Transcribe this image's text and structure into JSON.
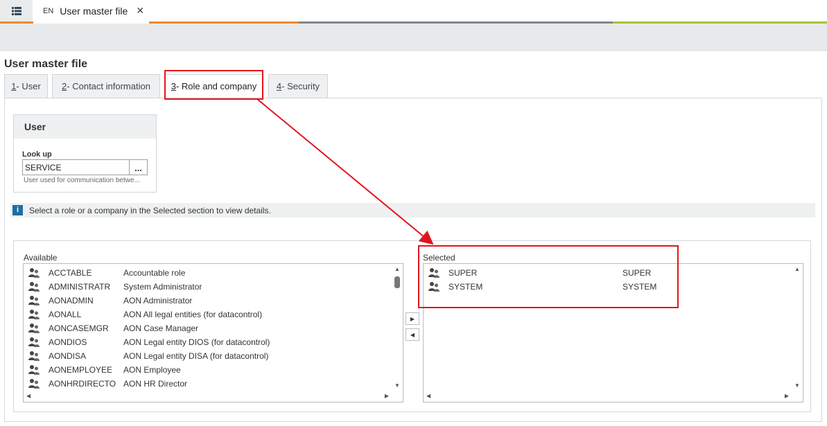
{
  "top_tab": {
    "lang": "EN",
    "title": "User master file",
    "close": "✕"
  },
  "page_title": "User master file",
  "tabs": [
    {
      "num": "1",
      "label": " - User"
    },
    {
      "num": "2",
      "label": " - Contact information"
    },
    {
      "num": "3",
      "label": " - Role and company"
    },
    {
      "num": "4",
      "label": " - Security"
    }
  ],
  "user_box": {
    "header": "User",
    "lookup_label": "Look up",
    "lookup_value": "SERVICE",
    "lookup_btn": "...",
    "help": "User used for communication betwe..."
  },
  "info": {
    "icon": "i",
    "text": "Select a role or a company in the Selected section to view details."
  },
  "available": {
    "label": "Available",
    "rows": [
      {
        "code": "ACCTABLE",
        "desc": "Accountable role"
      },
      {
        "code": "ADMINISTRATR",
        "desc": "System Administrator"
      },
      {
        "code": "AONADMIN",
        "desc": "AON Administrator"
      },
      {
        "code": "AONALL",
        "desc": "AON All legal entities (for datacontrol)"
      },
      {
        "code": "AONCASEMGR",
        "desc": "AON Case Manager"
      },
      {
        "code": "AONDIOS",
        "desc": "AON Legal entity DIOS (for datacontrol)"
      },
      {
        "code": "AONDISA",
        "desc": "AON Legal entity DISA (for datacontrol)"
      },
      {
        "code": "AONEMPLOYEE",
        "desc": "AON Employee"
      },
      {
        "code": "AONHRDIRECTO",
        "desc": "AON HR Director"
      }
    ]
  },
  "selected": {
    "label": "Selected",
    "rows": [
      {
        "code": "SUPER",
        "desc": "SUPER"
      },
      {
        "code": "SYSTEM",
        "desc": "SYSTEM"
      }
    ]
  },
  "icons": {
    "menu": "menu-list-icon",
    "role": "user-group-icon",
    "info": "info-icon"
  },
  "colors": {
    "stripe_orange": "#f0892f",
    "stripe_gray": "#7d868c",
    "stripe_green": "#a4c43a",
    "annotation_red": "#e2141b",
    "info_blue": "#1f6ea3"
  }
}
